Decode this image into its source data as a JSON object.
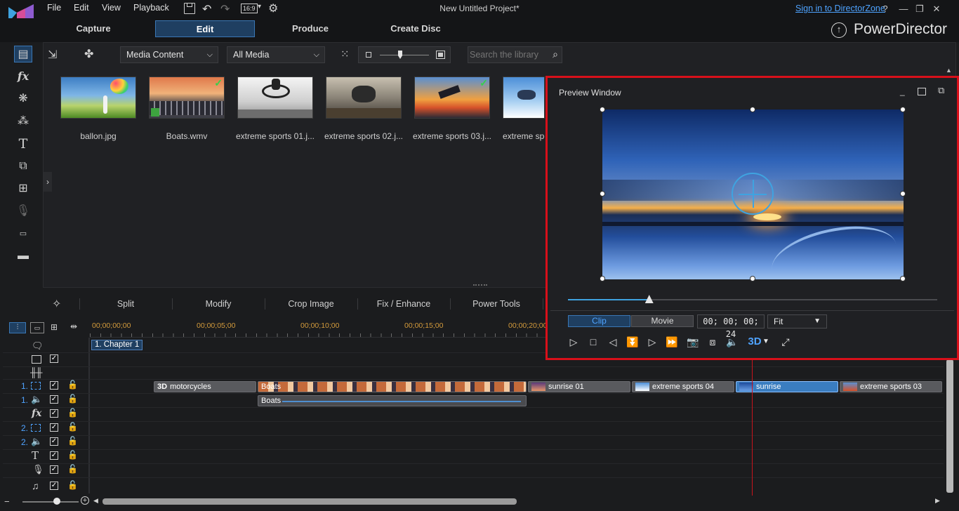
{
  "menu": {
    "items": [
      "File",
      "Edit",
      "View",
      "Playback"
    ],
    "aspect_ratio": "16:9",
    "project_title": "New Untitled Project*",
    "sign_in": "Sign in to DirectorZone",
    "help": "?"
  },
  "modes": {
    "tabs": [
      "Capture",
      "Edit",
      "Produce",
      "Create Disc"
    ],
    "active": "Edit",
    "brand": "PowerDirector"
  },
  "library": {
    "content_dropdown": "Media Content",
    "filter_dropdown": "All Media",
    "search_placeholder": "Search the library",
    "items": [
      {
        "label": "ballon.jpg",
        "checked": false
      },
      {
        "label": "Boats.wmv",
        "checked": true
      },
      {
        "label": "extreme sports 01.j...",
        "checked": false
      },
      {
        "label": "extreme sports 02.j...",
        "checked": false
      },
      {
        "label": "extreme sports 03.j...",
        "checked": true
      },
      {
        "label": "extreme spo",
        "checked": false
      }
    ]
  },
  "tools": {
    "split": "Split",
    "modify": "Modify",
    "crop": "Crop Image",
    "fix": "Fix / Enhance",
    "power": "Power Tools"
  },
  "timeline": {
    "ruler": [
      "00;00;00;00",
      "00;00;05;00",
      "00;00;10;00",
      "00;00;15;00",
      "00;00;20;00"
    ],
    "chapter": "1. Chapter 1",
    "track_numbers": [
      "1.",
      "1.",
      "2.",
      "2."
    ],
    "video_clips": [
      {
        "label": "motorcycles",
        "badge": "3D"
      },
      {
        "label": "Boats"
      },
      {
        "label": "sunrise 01"
      },
      {
        "label": "extreme sports 04"
      },
      {
        "label": "sunrise"
      },
      {
        "label": "extreme sports 03"
      }
    ],
    "audio_clip": "Boats"
  },
  "preview": {
    "title": "Preview Window",
    "clip_tab": "Clip",
    "movie_tab": "Movie",
    "timecode": "00; 00; 00; 24",
    "fit": "Fit",
    "three_d": "3D",
    "progress": 0.22
  },
  "colors": {
    "accent": "#3a77b5",
    "highlight_border": "#d8101a",
    "ruler_text": "#d49b3c"
  }
}
